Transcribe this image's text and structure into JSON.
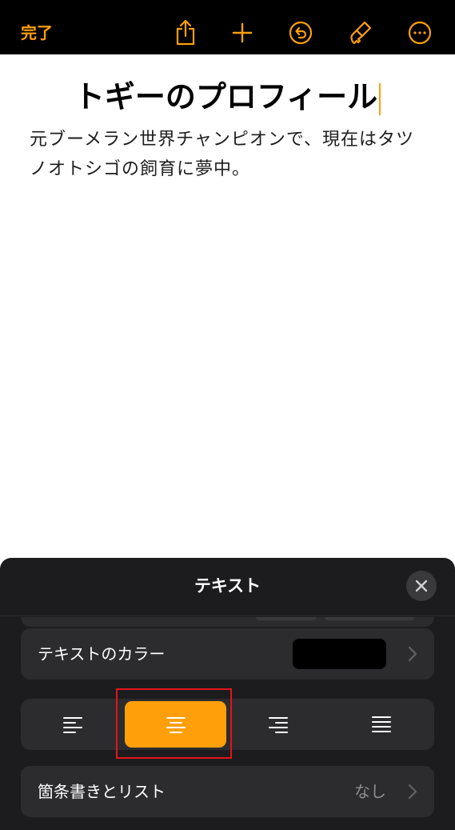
{
  "colors": {
    "accent": "#ff9f0a",
    "toolbar_bg": "#000000",
    "panel_bg": "#1c1c1e",
    "row_bg": "#2c2c2e",
    "text_color_swatch": "#000000",
    "highlight": "#e3141b"
  },
  "toolbar": {
    "done_label": "完了",
    "icons": [
      "share-icon",
      "add-icon",
      "undo-icon",
      "format-brush-icon",
      "more-icon"
    ]
  },
  "document": {
    "title": "トギーのプロフィール",
    "body": "元ブーメラン世界チャンピオンで、現在はタツノオトシゴの飼育に夢中。"
  },
  "panel": {
    "title": "テキスト",
    "text_color_label": "テキストのカラー",
    "alignment": {
      "options": [
        "align-left",
        "align-center",
        "align-right",
        "justify"
      ],
      "selected": "align-center"
    },
    "bullets_label": "箇条書きとリスト",
    "bullets_value": "なし"
  }
}
